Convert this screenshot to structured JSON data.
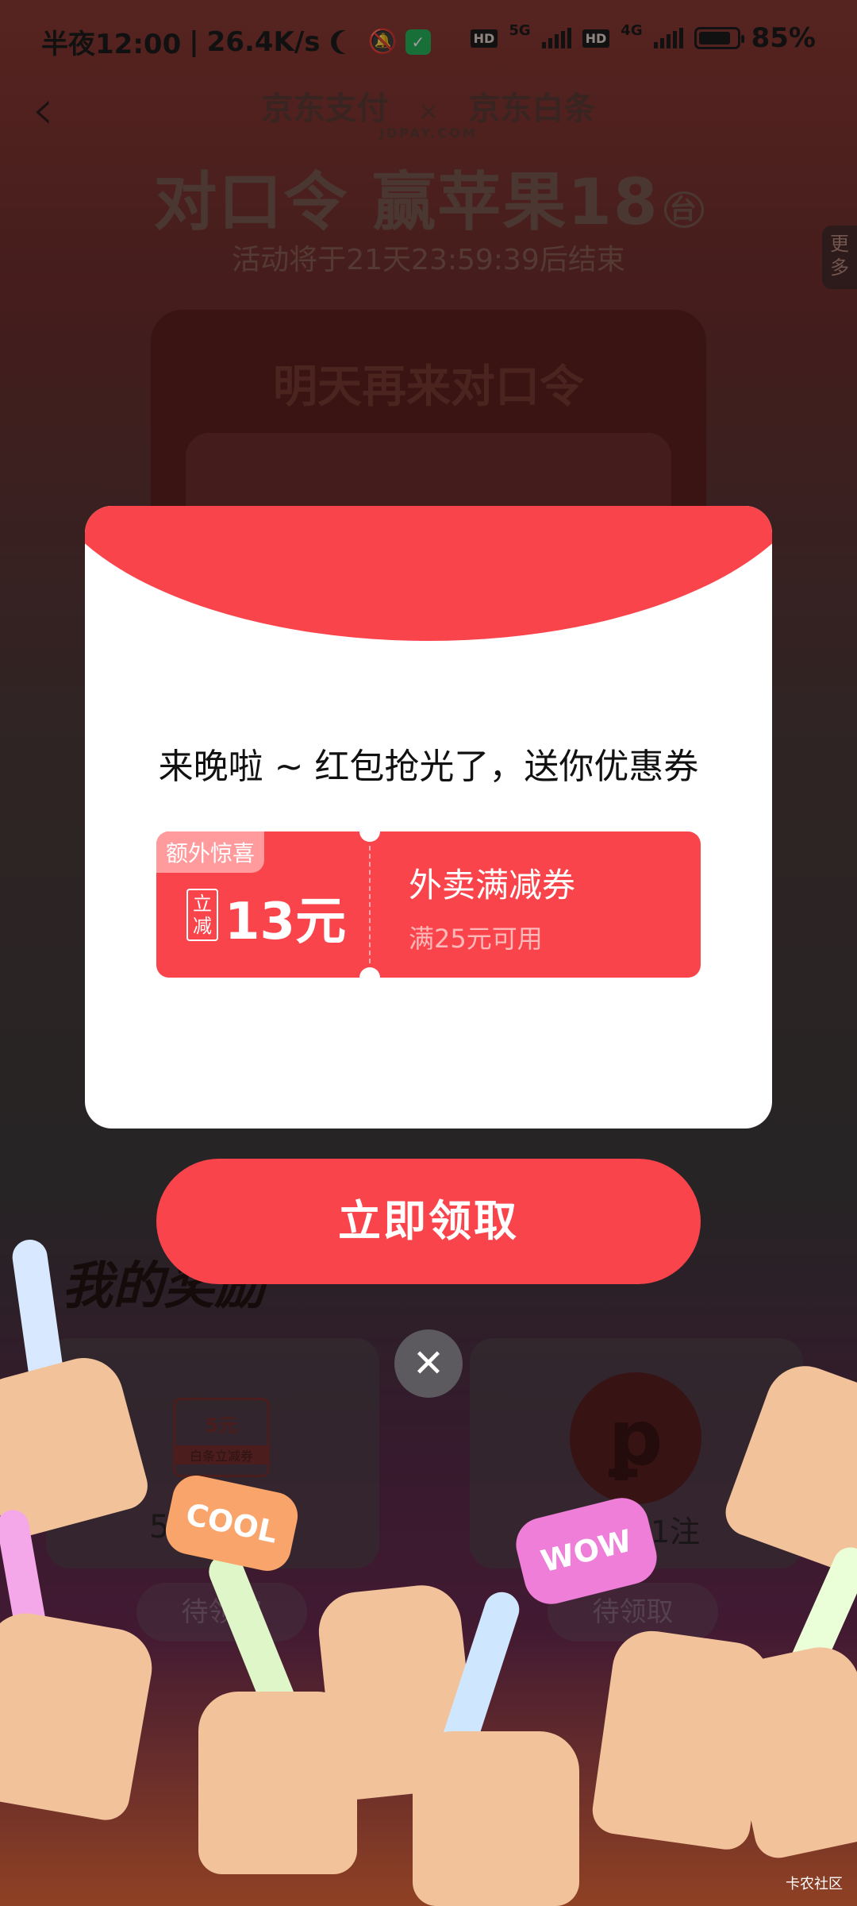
{
  "status_bar": {
    "time": "半夜12:00",
    "speed": "26.4K/s",
    "sim1_type": "5G",
    "sim2_type": "4G",
    "hd_label": "HD",
    "battery": "85%"
  },
  "header": {
    "back_icon": "chevron-left-icon",
    "logo_left": "京东支付",
    "logo_left_sub": "JDPAY.COM",
    "logo_sep": "×",
    "logo_right": "京东白条",
    "title": "对口令 赢苹果18",
    "title_unit": "台",
    "countdown": "活动将于21天23:59:39后结束",
    "side_tab": "更多"
  },
  "board": {
    "title": "明天再来对口令"
  },
  "rewards": {
    "section_title": "我的奖励",
    "mini_coupon_amount": "5元",
    "mini_coupon_label": "白条立减券",
    "left_label": "5",
    "right_label": "1注",
    "left_button": "待领取",
    "right_button": "待领取"
  },
  "modal": {
    "message": "来晚啦 ~ 红包抢光了，送你优惠券",
    "coupon": {
      "tag": "额外惊喜",
      "badge": "立减",
      "amount": "13元",
      "name": "外卖满减券",
      "condition": "满25元可用"
    },
    "claim_button": "立即领取",
    "close_icon": "close-icon"
  },
  "decorations": {
    "burst_left": "COOL",
    "burst_right": "WOW"
  },
  "watermark": "卡农社区",
  "colors": {
    "accent": "#fa444b",
    "coupon_tag": "#ff9a9d",
    "close_button": "#5c5a5e"
  }
}
